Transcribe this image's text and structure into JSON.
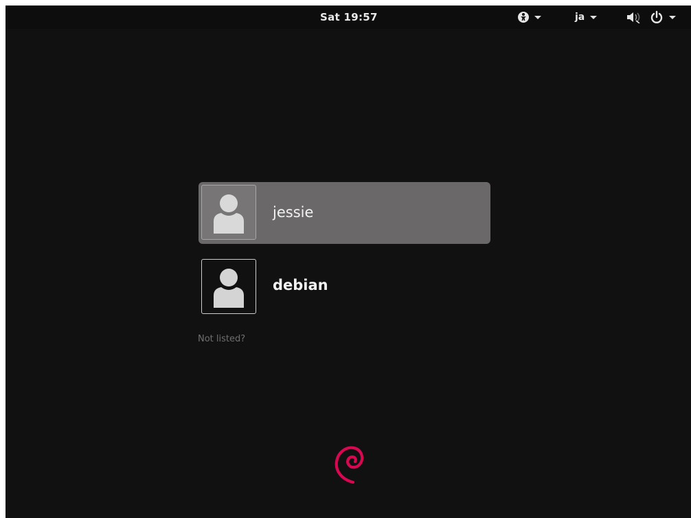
{
  "topbar": {
    "clock": "Sat 19:57",
    "accessibility_icon": "accessibility-icon",
    "language_label": "ja",
    "volume_icon": "volume-muted-icon",
    "power_icon": "power-icon"
  },
  "users": [
    {
      "name": "jessie",
      "selected": true,
      "avatar_icon": "user-avatar-icon"
    },
    {
      "name": "debian",
      "selected": false,
      "avatar_icon": "user-avatar-icon"
    }
  ],
  "not_listed": "Not listed?",
  "brand": {
    "logo_icon": "debian-swirl-icon",
    "color": "#d70751"
  },
  "colors": {
    "background": "#121111",
    "selected_row": "#6a6868"
  }
}
